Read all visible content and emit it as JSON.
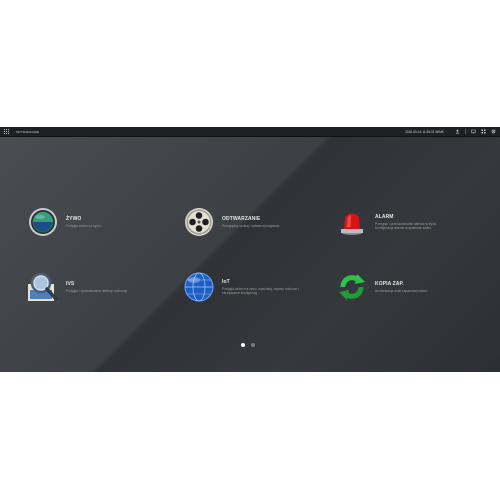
{
  "topbar": {
    "title": "ODTWARZANIE",
    "datetime": "2016-05-16 11:35:31 WIMK",
    "icons": [
      "user-icon",
      "monitor-icon",
      "grid-icon",
      "settings-icon"
    ]
  },
  "tiles": [
    {
      "title": "ŻYWO",
      "desc": "Podgląd wideo na żywo.",
      "icon": "live-lens-icon"
    },
    {
      "title": "ODTWARZANIE",
      "desc": "Przeglądaj, szukaj i odtwarzaj nagrania.",
      "icon": "film-reel-icon"
    },
    {
      "title": "ALARM",
      "desc": "Przegląd i przeszukiwanie alertów w życiu. Konfiguracja alarmu w systemie wideo.",
      "icon": "alarm-siren-icon"
    },
    {
      "title": "IVS",
      "desc": "Podgląd i wyszukiwanie detekcji ruchowej.",
      "icon": "magnifier-icon"
    },
    {
      "title": "IoT",
      "desc": "Podgląd wideo na żywo, wyszukaj, raporty ruchowe i zarządzanie inteligencją.",
      "icon": "globe-icon"
    },
    {
      "title": "KOPIA ZAP.",
      "desc": "Archiwizacja kopii zapasowej wideo.",
      "icon": "backup-refresh-icon"
    }
  ],
  "pagination": {
    "pages": 2,
    "active": 1
  }
}
